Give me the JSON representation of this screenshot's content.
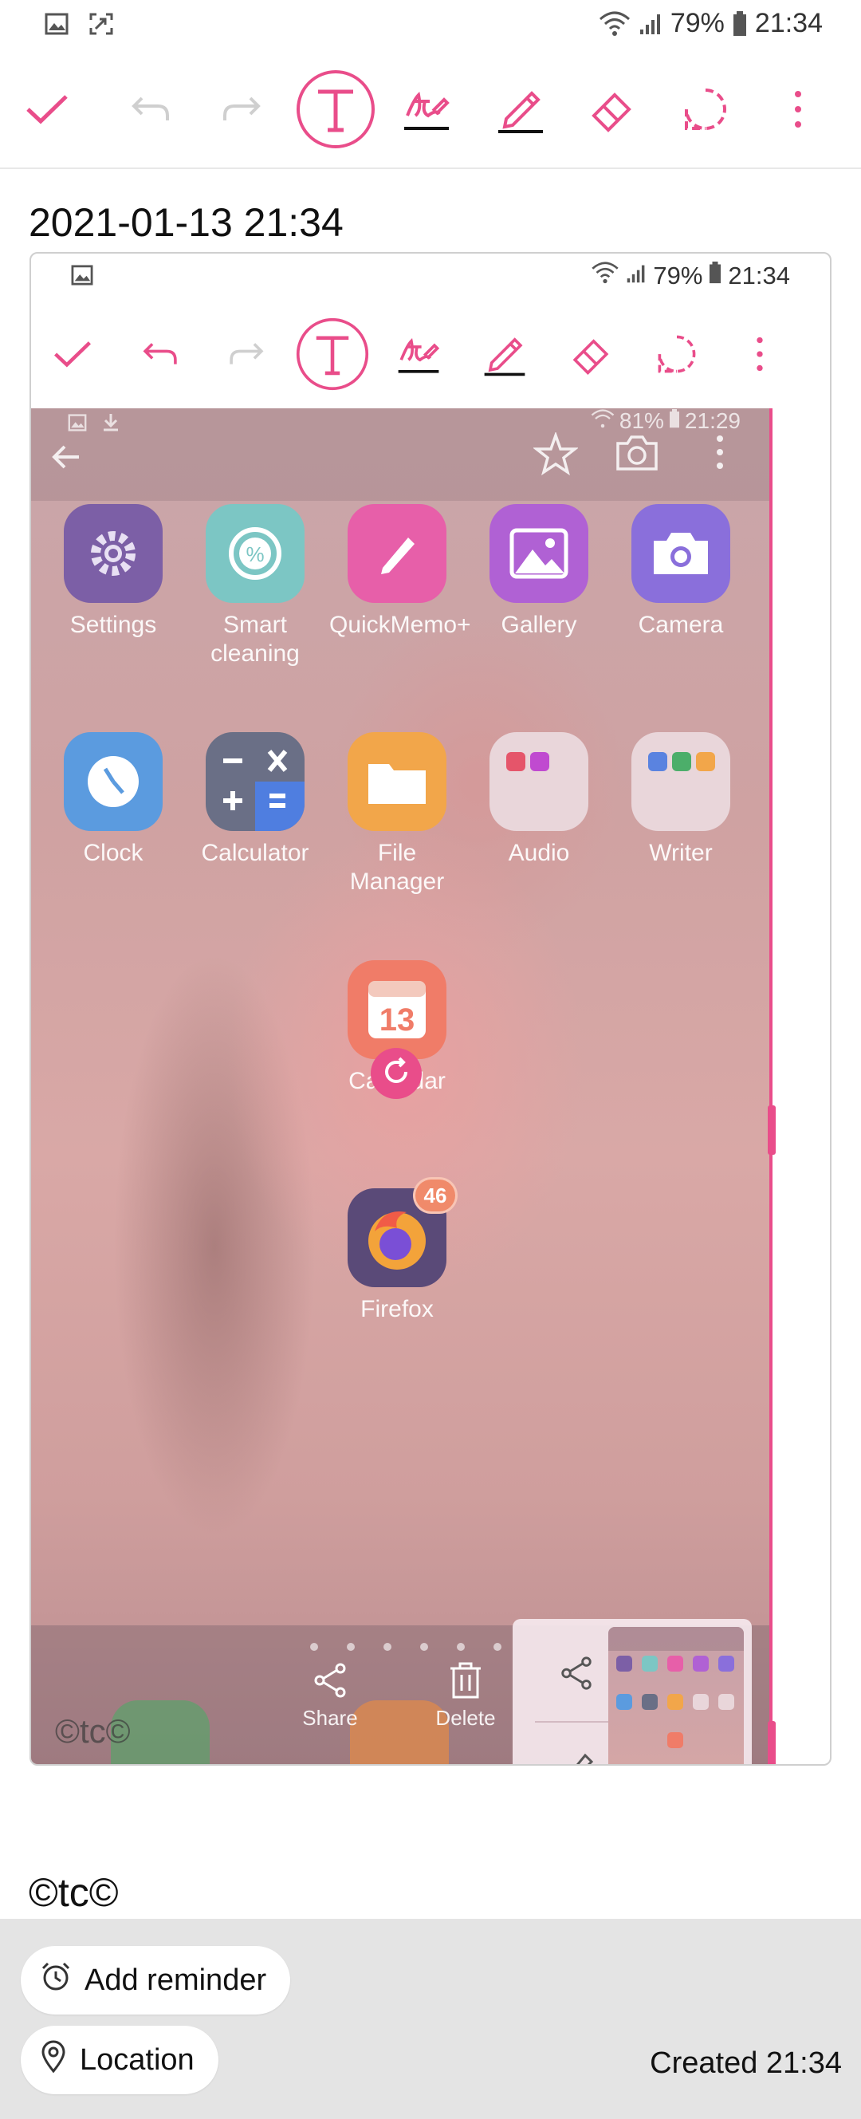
{
  "status_bar": {
    "battery": "79%",
    "time": "21:34"
  },
  "toolbar": {
    "items": [
      "check-icon",
      "undo-icon",
      "redo-icon",
      "text-mode-icon",
      "handwriting-icon",
      "pen-icon",
      "eraser-icon",
      "lasso-select-icon",
      "more-icon"
    ]
  },
  "note": {
    "date": "2021-01-13 21:34",
    "footer_text": "©tc©"
  },
  "embedded_screenshot": {
    "status": {
      "battery": "79%",
      "time": "21:34"
    },
    "inner_status": {
      "battery": "81%",
      "time": "21:29"
    },
    "apps": [
      {
        "label": "Settings"
      },
      {
        "label": "Smart\ncleaning"
      },
      {
        "label": "QuickMemo+"
      },
      {
        "label": "Gallery"
      },
      {
        "label": "Camera"
      },
      {
        "label": "Clock"
      },
      {
        "label": "Calculator"
      },
      {
        "label": "File\nManager"
      },
      {
        "label": "Audio"
      },
      {
        "label": "Writer"
      },
      {
        "label": "Calendar",
        "icon_text": "13"
      },
      {
        "label": "Firefox",
        "badge": "46"
      }
    ],
    "share_label": "Share",
    "delete_label": "Delete",
    "watermark": "©tc©"
  },
  "bottom_bar": {
    "add_reminder": "Add reminder",
    "location": "Location",
    "created": "Created 21:34"
  },
  "colors": {
    "accent": "#e94d8a",
    "bottom_bg": "#e4e4e4"
  }
}
